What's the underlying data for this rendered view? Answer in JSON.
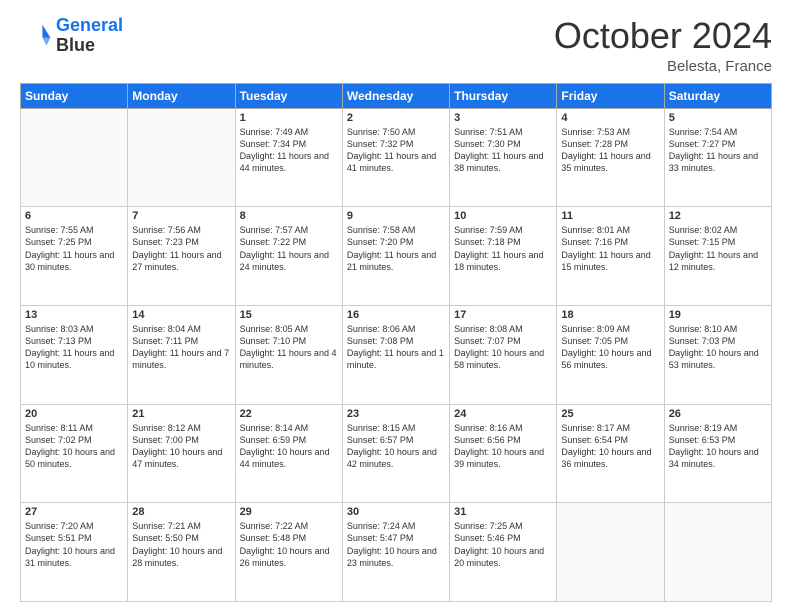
{
  "header": {
    "logo_line1": "General",
    "logo_line2": "Blue",
    "month": "October 2024",
    "location": "Belesta, France"
  },
  "weekdays": [
    "Sunday",
    "Monday",
    "Tuesday",
    "Wednesday",
    "Thursday",
    "Friday",
    "Saturday"
  ],
  "weeks": [
    [
      {
        "day": null
      },
      {
        "day": null
      },
      {
        "day": "1",
        "sunrise": "Sunrise: 7:49 AM",
        "sunset": "Sunset: 7:34 PM",
        "daylight": "Daylight: 11 hours and 44 minutes."
      },
      {
        "day": "2",
        "sunrise": "Sunrise: 7:50 AM",
        "sunset": "Sunset: 7:32 PM",
        "daylight": "Daylight: 11 hours and 41 minutes."
      },
      {
        "day": "3",
        "sunrise": "Sunrise: 7:51 AM",
        "sunset": "Sunset: 7:30 PM",
        "daylight": "Daylight: 11 hours and 38 minutes."
      },
      {
        "day": "4",
        "sunrise": "Sunrise: 7:53 AM",
        "sunset": "Sunset: 7:28 PM",
        "daylight": "Daylight: 11 hours and 35 minutes."
      },
      {
        "day": "5",
        "sunrise": "Sunrise: 7:54 AM",
        "sunset": "Sunset: 7:27 PM",
        "daylight": "Daylight: 11 hours and 33 minutes."
      }
    ],
    [
      {
        "day": "6",
        "sunrise": "Sunrise: 7:55 AM",
        "sunset": "Sunset: 7:25 PM",
        "daylight": "Daylight: 11 hours and 30 minutes."
      },
      {
        "day": "7",
        "sunrise": "Sunrise: 7:56 AM",
        "sunset": "Sunset: 7:23 PM",
        "daylight": "Daylight: 11 hours and 27 minutes."
      },
      {
        "day": "8",
        "sunrise": "Sunrise: 7:57 AM",
        "sunset": "Sunset: 7:22 PM",
        "daylight": "Daylight: 11 hours and 24 minutes."
      },
      {
        "day": "9",
        "sunrise": "Sunrise: 7:58 AM",
        "sunset": "Sunset: 7:20 PM",
        "daylight": "Daylight: 11 hours and 21 minutes."
      },
      {
        "day": "10",
        "sunrise": "Sunrise: 7:59 AM",
        "sunset": "Sunset: 7:18 PM",
        "daylight": "Daylight: 11 hours and 18 minutes."
      },
      {
        "day": "11",
        "sunrise": "Sunrise: 8:01 AM",
        "sunset": "Sunset: 7:16 PM",
        "daylight": "Daylight: 11 hours and 15 minutes."
      },
      {
        "day": "12",
        "sunrise": "Sunrise: 8:02 AM",
        "sunset": "Sunset: 7:15 PM",
        "daylight": "Daylight: 11 hours and 12 minutes."
      }
    ],
    [
      {
        "day": "13",
        "sunrise": "Sunrise: 8:03 AM",
        "sunset": "Sunset: 7:13 PM",
        "daylight": "Daylight: 11 hours and 10 minutes."
      },
      {
        "day": "14",
        "sunrise": "Sunrise: 8:04 AM",
        "sunset": "Sunset: 7:11 PM",
        "daylight": "Daylight: 11 hours and 7 minutes."
      },
      {
        "day": "15",
        "sunrise": "Sunrise: 8:05 AM",
        "sunset": "Sunset: 7:10 PM",
        "daylight": "Daylight: 11 hours and 4 minutes."
      },
      {
        "day": "16",
        "sunrise": "Sunrise: 8:06 AM",
        "sunset": "Sunset: 7:08 PM",
        "daylight": "Daylight: 11 hours and 1 minute."
      },
      {
        "day": "17",
        "sunrise": "Sunrise: 8:08 AM",
        "sunset": "Sunset: 7:07 PM",
        "daylight": "Daylight: 10 hours and 58 minutes."
      },
      {
        "day": "18",
        "sunrise": "Sunrise: 8:09 AM",
        "sunset": "Sunset: 7:05 PM",
        "daylight": "Daylight: 10 hours and 56 minutes."
      },
      {
        "day": "19",
        "sunrise": "Sunrise: 8:10 AM",
        "sunset": "Sunset: 7:03 PM",
        "daylight": "Daylight: 10 hours and 53 minutes."
      }
    ],
    [
      {
        "day": "20",
        "sunrise": "Sunrise: 8:11 AM",
        "sunset": "Sunset: 7:02 PM",
        "daylight": "Daylight: 10 hours and 50 minutes."
      },
      {
        "day": "21",
        "sunrise": "Sunrise: 8:12 AM",
        "sunset": "Sunset: 7:00 PM",
        "daylight": "Daylight: 10 hours and 47 minutes."
      },
      {
        "day": "22",
        "sunrise": "Sunrise: 8:14 AM",
        "sunset": "Sunset: 6:59 PM",
        "daylight": "Daylight: 10 hours and 44 minutes."
      },
      {
        "day": "23",
        "sunrise": "Sunrise: 8:15 AM",
        "sunset": "Sunset: 6:57 PM",
        "daylight": "Daylight: 10 hours and 42 minutes."
      },
      {
        "day": "24",
        "sunrise": "Sunrise: 8:16 AM",
        "sunset": "Sunset: 6:56 PM",
        "daylight": "Daylight: 10 hours and 39 minutes."
      },
      {
        "day": "25",
        "sunrise": "Sunrise: 8:17 AM",
        "sunset": "Sunset: 6:54 PM",
        "daylight": "Daylight: 10 hours and 36 minutes."
      },
      {
        "day": "26",
        "sunrise": "Sunrise: 8:19 AM",
        "sunset": "Sunset: 6:53 PM",
        "daylight": "Daylight: 10 hours and 34 minutes."
      }
    ],
    [
      {
        "day": "27",
        "sunrise": "Sunrise: 7:20 AM",
        "sunset": "Sunset: 5:51 PM",
        "daylight": "Daylight: 10 hours and 31 minutes."
      },
      {
        "day": "28",
        "sunrise": "Sunrise: 7:21 AM",
        "sunset": "Sunset: 5:50 PM",
        "daylight": "Daylight: 10 hours and 28 minutes."
      },
      {
        "day": "29",
        "sunrise": "Sunrise: 7:22 AM",
        "sunset": "Sunset: 5:48 PM",
        "daylight": "Daylight: 10 hours and 26 minutes."
      },
      {
        "day": "30",
        "sunrise": "Sunrise: 7:24 AM",
        "sunset": "Sunset: 5:47 PM",
        "daylight": "Daylight: 10 hours and 23 minutes."
      },
      {
        "day": "31",
        "sunrise": "Sunrise: 7:25 AM",
        "sunset": "Sunset: 5:46 PM",
        "daylight": "Daylight: 10 hours and 20 minutes."
      },
      {
        "day": null
      },
      {
        "day": null
      }
    ]
  ]
}
